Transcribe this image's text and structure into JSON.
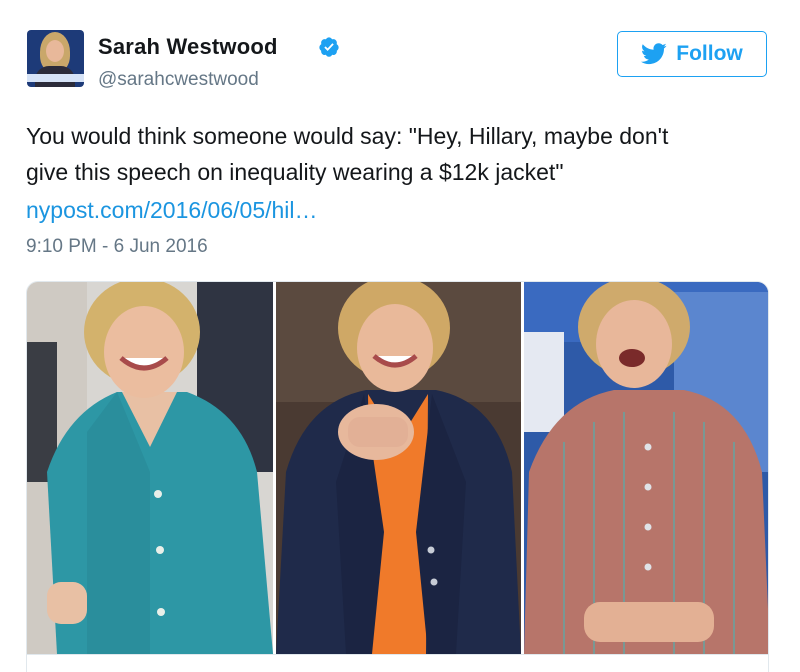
{
  "author": {
    "name": "Sarah Westwood",
    "handle": "@sarahcwestwood",
    "verified": true,
    "avatar_icon": "profile-photo"
  },
  "follow_button": {
    "label": "Follow",
    "icon": "twitter-bird-icon"
  },
  "tweet": {
    "text_lines": [
      "You would think someone would say: \"Hey, Hillary, maybe don't",
      "give this speech on inequality wearing a $12k jacket\""
    ],
    "link": "nypost.com/2016/06/05/hil…",
    "timestamp": "9:10 PM - 6 Jun 2016"
  },
  "media": {
    "photos": [
      {
        "description_icon": "photo-teal-jacket"
      },
      {
        "description_icon": "photo-navy-blazer"
      },
      {
        "description_icon": "photo-tweed-jacket"
      }
    ]
  },
  "colors": {
    "accent": "#1da1f2",
    "link": "#1b95e0",
    "text": "#14171a",
    "muted": "#657786",
    "border": "#e1e8ed"
  }
}
